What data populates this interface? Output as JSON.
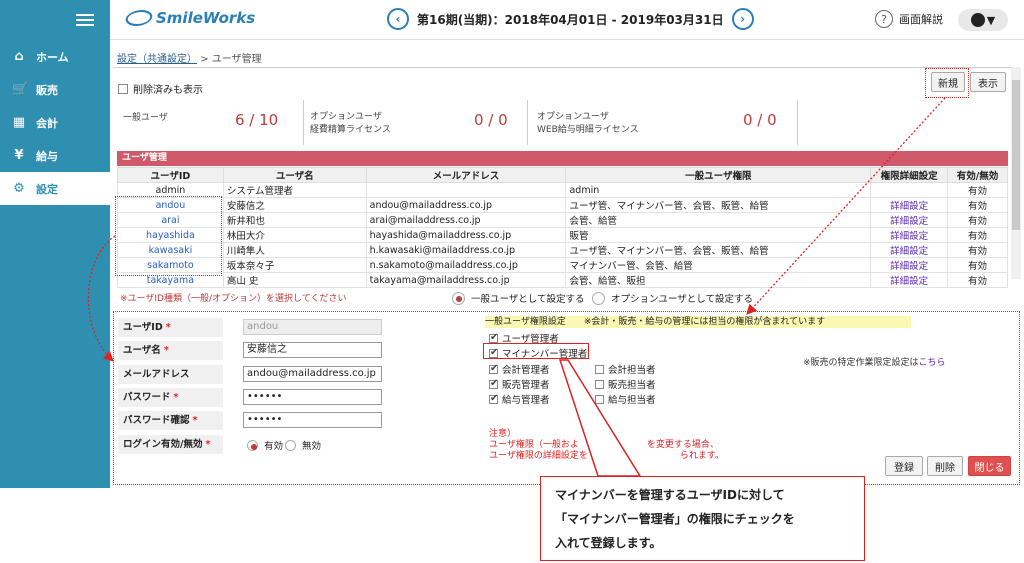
{
  "header": {
    "logo": "SmileWorks",
    "period": "第16期(当期)：2018年04月01日 - 2019年03月31日",
    "prev_icon": "chevron-left-icon",
    "next_icon": "chevron-right-icon",
    "help_label": "画面解説",
    "help_icon": "?",
    "user_caret": "▼"
  },
  "sidebar": {
    "items": [
      {
        "label": "ホーム",
        "icon": "⌂"
      },
      {
        "label": "販売",
        "icon": "🛒"
      },
      {
        "label": "会計",
        "icon": "▦"
      },
      {
        "label": "給与",
        "icon": "¥"
      },
      {
        "label": "設定",
        "icon": "⚙"
      }
    ]
  },
  "breadcrumb": {
    "parent": "設定（共通設定）",
    "sep": ">",
    "current": "ユーザ管理"
  },
  "show_deleted_label": "削除済みも表示",
  "buttons": {
    "new": "新規",
    "display": "表示",
    "register": "登録",
    "delete": "削除",
    "close": "閉じる"
  },
  "summary": {
    "general_label": "一般ユーザ",
    "general_value": "6 / 10",
    "opt1_label1": "オプションユーザ",
    "opt1_label2": "経費精算ライセンス",
    "opt1_value": "0 / 0",
    "opt2_label1": "オプションユーザ",
    "opt2_label2": "WEB給与明細ライセンス",
    "opt2_value": "0 / 0"
  },
  "grid": {
    "title": "ユーザ管理",
    "columns": [
      "ユーザID",
      "ユーザ名",
      "メールアドレス",
      "一般ユーザ権限",
      "権限詳細設定",
      "有効/無効"
    ],
    "rows": [
      {
        "id": "admin",
        "name": "システム管理者",
        "email": "",
        "perm": "admin",
        "detail": "",
        "status": "有効"
      },
      {
        "id": "andou",
        "name": "安藤信之",
        "email": "andou@mailaddress.co.jp",
        "perm": "ユーザ管、マイナンバー管、会管、販管、給管",
        "detail": "詳細設定",
        "status": "有効"
      },
      {
        "id": "arai",
        "name": "新井和也",
        "email": "arai@mailaddress.co.jp",
        "perm": "会管、給管",
        "detail": "詳細設定",
        "status": "有効"
      },
      {
        "id": "hayashida",
        "name": "林田大介",
        "email": "hayashida@mailaddress.co.jp",
        "perm": "販管",
        "detail": "詳細設定",
        "status": "有効"
      },
      {
        "id": "kawasaki",
        "name": "川崎隼人",
        "email": "h.kawasaki@mailaddress.co.jp",
        "perm": "ユーザ管、マイナンバー管、会管、販管、給管",
        "detail": "詳細設定",
        "status": "有効"
      },
      {
        "id": "sakamoto",
        "name": "坂本奈々子",
        "email": "n.sakamoto@mailaddress.co.jp",
        "perm": "マイナンバー管、会管、給管",
        "detail": "詳細設定",
        "status": "有効"
      },
      {
        "id": "takayama",
        "name": "高山 史",
        "email": "takayama@mailaddress.co.jp",
        "perm": "会管、給管、販担",
        "detail": "詳細設定",
        "status": "有効"
      }
    ]
  },
  "form": {
    "select_note": "※ユーザID種類（一般/オプション）を選択してください",
    "radio_general": "一般ユーザとして設定する",
    "radio_option": "オプションユーザとして設定する",
    "labels": {
      "user_id": "ユーザID",
      "user_name": "ユーザ名",
      "email": "メールアドレス",
      "password": "パスワード",
      "password_confirm": "パスワード確認",
      "login": "ログイン有効/無効"
    },
    "required_mark": "*",
    "values": {
      "user_id": "andou",
      "user_name": "安藤信之",
      "email": "andou@mailaddress.co.jp",
      "password": "••••••",
      "password_confirm": "••••••"
    },
    "login_on": "有効",
    "login_off": "無効"
  },
  "permissions": {
    "title": "一般ユーザ権限設定　　※会計・販売・給与の管理には担当の権限が含まれています",
    "user_admin": "ユーザ管理者",
    "mynumber_admin": "マイナンバー管理者",
    "acct_admin": "会計管理者",
    "acct_staff": "会計担当者",
    "sales_admin": "販売管理者",
    "sales_staff": "販売担当者",
    "payroll_admin": "給与管理者",
    "payroll_staff": "給与担当者",
    "tokutei_prefix": "※販売の特定作業限定設定は",
    "tokutei_link": "こちら"
  },
  "caution": {
    "line1": "注意）",
    "line2": "ユーザ権限（一般およ",
    "line2b": "を変更する場合、",
    "line3": "ユーザ権限の詳細設定を",
    "line3b": "られます。"
  },
  "callout": {
    "line1": "マイナンバーを管理するユーザIDに対して",
    "line2": "「マイナンバー管理者」の権限にチェックを",
    "line3": "入れて登録します。"
  },
  "colors": {
    "sidebar": "#2f8fb0",
    "accent_red": "#d22222",
    "grid_header": "#d05a6a"
  }
}
